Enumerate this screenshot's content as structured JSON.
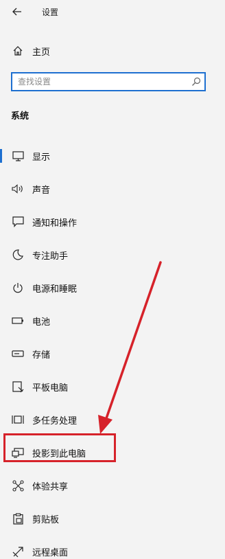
{
  "window": {
    "title": "设置"
  },
  "home": {
    "label": "主页"
  },
  "search": {
    "placeholder": "查找设置"
  },
  "section": {
    "title": "系统"
  },
  "nav": [
    {
      "label": "显示",
      "icon": "monitor-icon"
    },
    {
      "label": "声音",
      "icon": "speaker-icon"
    },
    {
      "label": "通知和操作",
      "icon": "message-icon"
    },
    {
      "label": "专注助手",
      "icon": "moon-icon"
    },
    {
      "label": "电源和睡眠",
      "icon": "power-icon"
    },
    {
      "label": "电池",
      "icon": "battery-icon"
    },
    {
      "label": "存储",
      "icon": "storage-icon"
    },
    {
      "label": "平板电脑",
      "icon": "tablet-icon"
    },
    {
      "label": "多任务处理",
      "icon": "multitask-icon"
    },
    {
      "label": "投影到此电脑",
      "icon": "project-icon"
    },
    {
      "label": "体验共享",
      "icon": "share-icon"
    },
    {
      "label": "剪贴板",
      "icon": "clipboard-icon"
    },
    {
      "label": "远程桌面",
      "icon": "remote-icon"
    }
  ],
  "selected_item": "显示",
  "highlighted_item": "投影到此电脑",
  "colors": {
    "accent": "#1d6fd0",
    "annotation": "#d6222a"
  }
}
